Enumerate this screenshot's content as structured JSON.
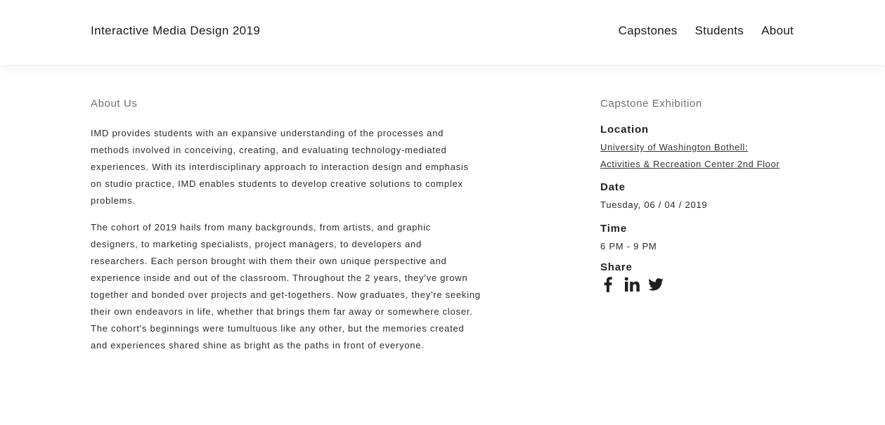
{
  "header": {
    "site_title": "Interactive Media Design 2019",
    "nav": [
      {
        "label": "Capstones"
      },
      {
        "label": "Students"
      },
      {
        "label": "About"
      }
    ]
  },
  "about": {
    "heading": "About Us",
    "paragraphs": [
      "IMD provides students with an expansive understanding of the processes and methods involved in conceiving, creating, and evaluating technology-mediated experiences. With its interdisciplinary approach to interaction design and emphasis on studio practice, IMD enables students to develop creative solutions to complex problems.",
      "The cohort of 2019 hails from many backgrounds, from artists, and graphic designers, to marketing specialists, project managers, to developers and researchers. Each person brought with them their own unique perspective and experience inside and out of the classroom. Throughout the 2 years, they've grown together and bonded over projects and get-togethers. Now graduates, they're seeking their own endeavors in life, whether that brings them far away or somewhere closer. The cohort's beginnings were tumultuous like any other, but the memories created and experiences shared shine as bright as the paths in front of everyone."
    ]
  },
  "exhibition": {
    "heading": "Capstone Exhibition",
    "location_label": "Location",
    "location_line1": "University of Washington Bothell:",
    "location_line2": "Activities & Recreation Center 2nd Floor",
    "date_label": "Date",
    "date_value": "Tuesday, 06 / 04 / 2019",
    "time_label": "Time",
    "time_value": "6 PM - 9 PM",
    "share_label": "Share",
    "share_icons": [
      "facebook-icon",
      "linkedin-icon",
      "twitter-icon"
    ]
  }
}
